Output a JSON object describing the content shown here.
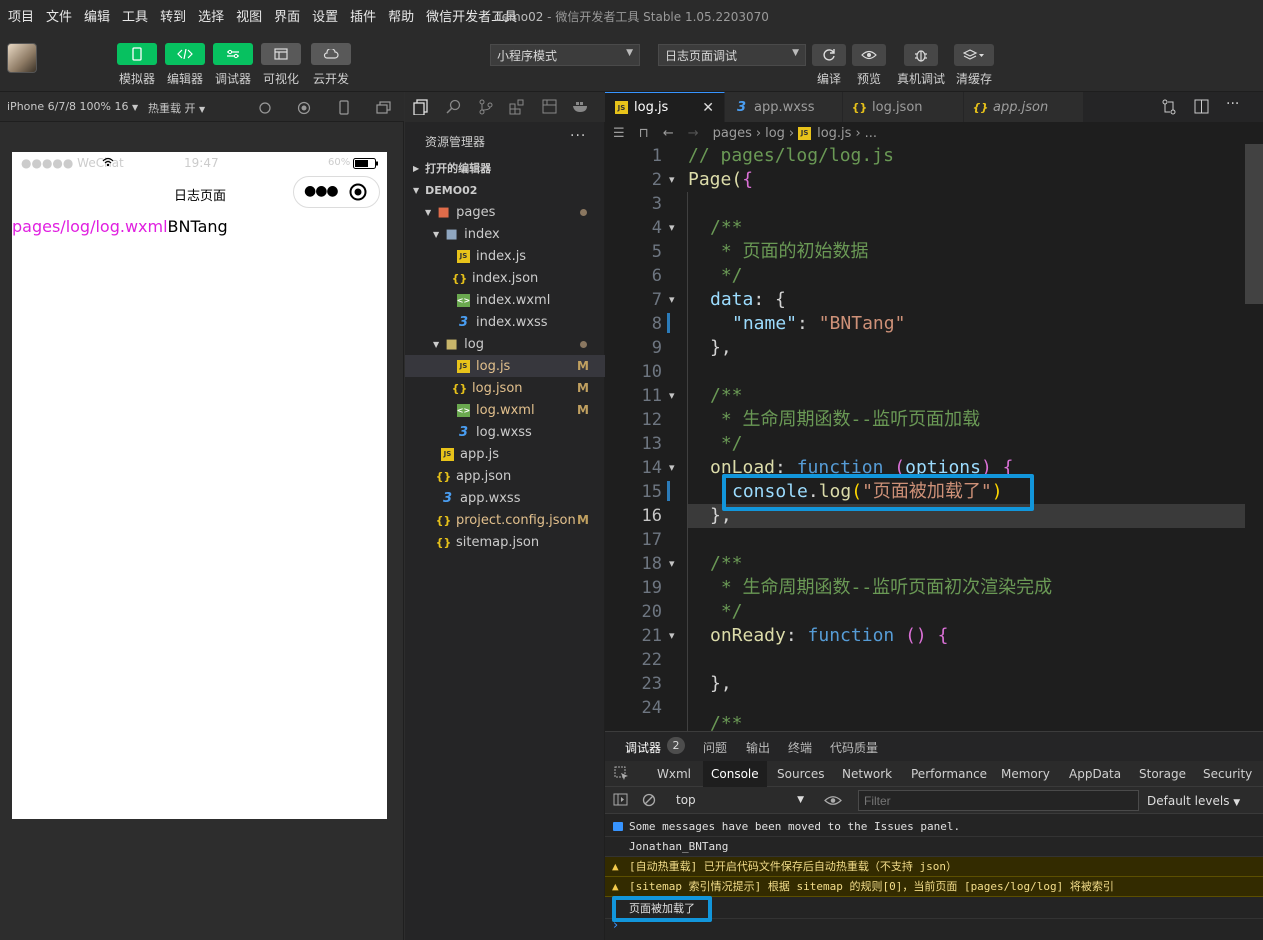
{
  "menu": [
    "项目",
    "文件",
    "编辑",
    "工具",
    "转到",
    "选择",
    "视图",
    "界面",
    "设置",
    "插件",
    "帮助",
    "微信开发者工具"
  ],
  "window_title": {
    "project": "demo02",
    "app": "微信开发者工具 Stable 1.05.2203070",
    "separator": " - "
  },
  "toolbar": {
    "buttons": [
      {
        "label": "模拟器"
      },
      {
        "label": "编辑器"
      },
      {
        "label": "调试器"
      },
      {
        "label": "可视化"
      },
      {
        "label": "云开发"
      }
    ],
    "mode_select": "小程序模式",
    "compile_select": "日志页面调试",
    "actions": [
      "编译",
      "预览",
      "真机调试",
      "清缓存"
    ]
  },
  "simulator": {
    "device": "iPhone 6/7/8 100% 16",
    "hot_reload": "热重载 开",
    "status_carrier": "●●●●● WeChat",
    "status_time": "19:47",
    "status_battery": "60%",
    "nav_title": "日志页面",
    "content_path": "pages/log/log.wxml",
    "content_name": "BNTang"
  },
  "explorer": {
    "title": "资源管理器",
    "open_editors": "打开的编辑器",
    "project": "DEMO02",
    "items": [
      {
        "name": "pages",
        "type": "folder"
      },
      {
        "name": "index",
        "type": "folder"
      },
      {
        "name": "index.js",
        "type": "js"
      },
      {
        "name": "index.json",
        "type": "json"
      },
      {
        "name": "index.wxml",
        "type": "wxml"
      },
      {
        "name": "index.wxss",
        "type": "wxss"
      },
      {
        "name": "log",
        "type": "folder"
      },
      {
        "name": "log.js",
        "type": "js",
        "mark": "M"
      },
      {
        "name": "log.json",
        "type": "json",
        "mark": "M"
      },
      {
        "name": "log.wxml",
        "type": "wxml",
        "mark": "M"
      },
      {
        "name": "log.wxss",
        "type": "wxss"
      },
      {
        "name": "app.js",
        "type": "js"
      },
      {
        "name": "app.json",
        "type": "json"
      },
      {
        "name": "app.wxss",
        "type": "wxss"
      },
      {
        "name": "project.config.json",
        "type": "json",
        "mark": "M"
      },
      {
        "name": "sitemap.json",
        "type": "json"
      }
    ]
  },
  "editor": {
    "tabs": [
      "log.js",
      "app.wxss",
      "log.json",
      "app.json"
    ],
    "breadcrumb": [
      "pages",
      "log",
      "log.js",
      "..."
    ],
    "lines": [
      "1",
      "2",
      "3",
      "4",
      "5",
      "6",
      "7",
      "8",
      "9",
      "10",
      "11",
      "12",
      "13",
      "14",
      "15",
      "16",
      "17",
      "18",
      "19",
      "20",
      "21",
      "22",
      "23",
      "24"
    ],
    "code": {
      "l1": "// pages/log/log.js",
      "l2a": "Page(",
      "l2b": "{",
      "l4": "/**",
      "l5": " * 页面的初始数据",
      "l6": " */",
      "l7a": "data",
      "l7b": ": {",
      "l8a": "\"name\"",
      "l8b": ": ",
      "l8c": "\"BNTang\"",
      "l9": "},",
      "l11": "/**",
      "l12": " * 生命周期函数--监听页面加载",
      "l13": " */",
      "l14a": "onLoad",
      "l14b": ": ",
      "l14c": "function",
      "l14d": " (",
      "l14e": "options",
      "l14f": ") {",
      "l15a": "console",
      "l15b": ".",
      "l15c": "log",
      "l15d": "(",
      "l15e": "\"页面被加载了\"",
      "l15f": ")",
      "l16": "},",
      "l18": "/**",
      "l19": " * 生命周期函数--监听页面初次渲染完成",
      "l20": " */",
      "l21a": "onReady",
      "l21b": ": ",
      "l21c": "function",
      "l21d": " () {",
      "l23": "},",
      "l24": "/**"
    }
  },
  "devtools": {
    "tabs": [
      "调试器",
      "问题",
      "输出",
      "终端",
      "代码质量"
    ],
    "badge": "2",
    "panels": [
      "Wxml",
      "Console",
      "Sources",
      "Network",
      "Performance",
      "Memory",
      "AppData",
      "Storage",
      "Security"
    ],
    "context": "top",
    "filter_placeholder": "Filter",
    "levels": "Default levels",
    "messages": [
      {
        "text": "Some messages have been moved to the Issues panel.",
        "kind": "info"
      },
      {
        "text": "Jonathan_BNTang",
        "kind": "log"
      },
      {
        "text": "[自动热重载] 已开启代码文件保存后自动热重载（不支持 json）",
        "kind": "warn"
      },
      {
        "text": "[sitemap 索引情况提示] 根据 sitemap 的规则[0]，当前页面 [pages/log/log] 将被索引",
        "kind": "warn"
      },
      {
        "text": "页面被加载了",
        "kind": "log"
      }
    ]
  },
  "colors": {
    "accent_green": "#07c160",
    "highlight_blue": "#1296db",
    "brand_pink": "#e020e0"
  }
}
